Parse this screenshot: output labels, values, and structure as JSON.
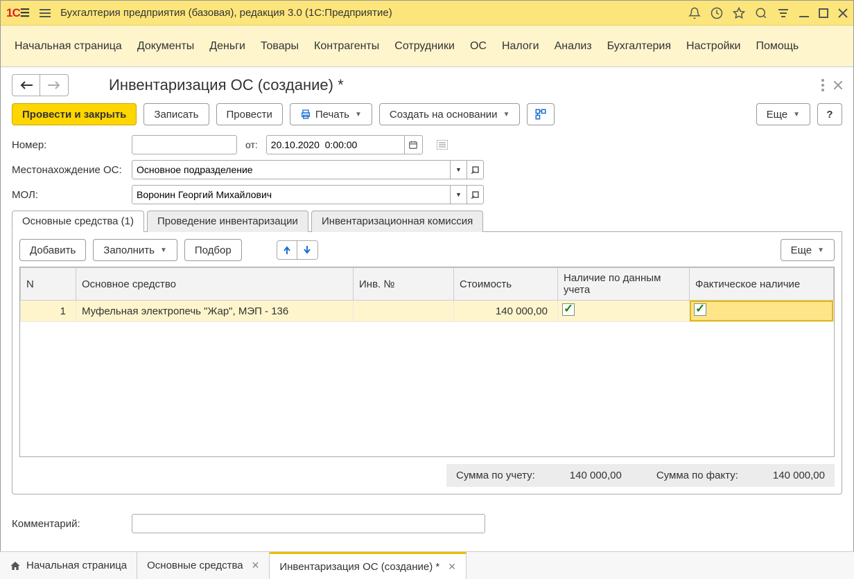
{
  "app": {
    "title": "Бухгалтерия предприятия (базовая), редакция 3.0  (1С:Предприятие)"
  },
  "menu": [
    "Начальная страница",
    "Документы",
    "Деньги",
    "Товары",
    "Контрагенты",
    "Сотрудники",
    "ОС",
    "Налоги",
    "Анализ",
    "Бухгалтерия",
    "Настройки",
    "Помощь"
  ],
  "page": {
    "title": "Инвентаризация ОС (создание) *"
  },
  "toolbar": {
    "post_close": "Провести и закрыть",
    "write": "Записать",
    "post": "Провести",
    "print": "Печать",
    "create_based": "Создать на основании",
    "more": "Еще",
    "help": "?"
  },
  "form": {
    "number_label": "Номер:",
    "number_value": "",
    "from_label": "от:",
    "date_value": "20.10.2020  0:00:00",
    "location_label": "Местонахождение ОС:",
    "location_value": "Основное подразделение",
    "mol_label": "МОЛ:",
    "mol_value": "Воронин Георгий Михайлович"
  },
  "tabs": {
    "t1": "Основные средства (1)",
    "t2": "Проведение инвентаризации",
    "t3": "Инвентаризационная комиссия"
  },
  "tab_toolbar": {
    "add": "Добавить",
    "fill": "Заполнить",
    "select": "Подбор",
    "more": "Еще"
  },
  "table": {
    "headers": {
      "n": "N",
      "os": "Основное средство",
      "inv": "Инв. №",
      "cost": "Стоимость",
      "avail_data": "Наличие по данным учета",
      "avail_fact": "Фактическое наличие"
    },
    "rows": [
      {
        "n": "1",
        "os": "Муфельная электропечь \"Жар\", МЭП - 136",
        "inv": "",
        "cost": "140 000,00",
        "avail_data": true,
        "avail_fact": true
      }
    ]
  },
  "totals": {
    "by_data_label": "Сумма по учету:",
    "by_data_value": "140 000,00",
    "by_fact_label": "Сумма по факту:",
    "by_fact_value": "140 000,00"
  },
  "comment": {
    "label": "Комментарий:",
    "value": ""
  },
  "bottom_tabs": {
    "home": "Начальная страница",
    "t1": "Основные средства",
    "t2": "Инвентаризация ОС (создание) *"
  }
}
